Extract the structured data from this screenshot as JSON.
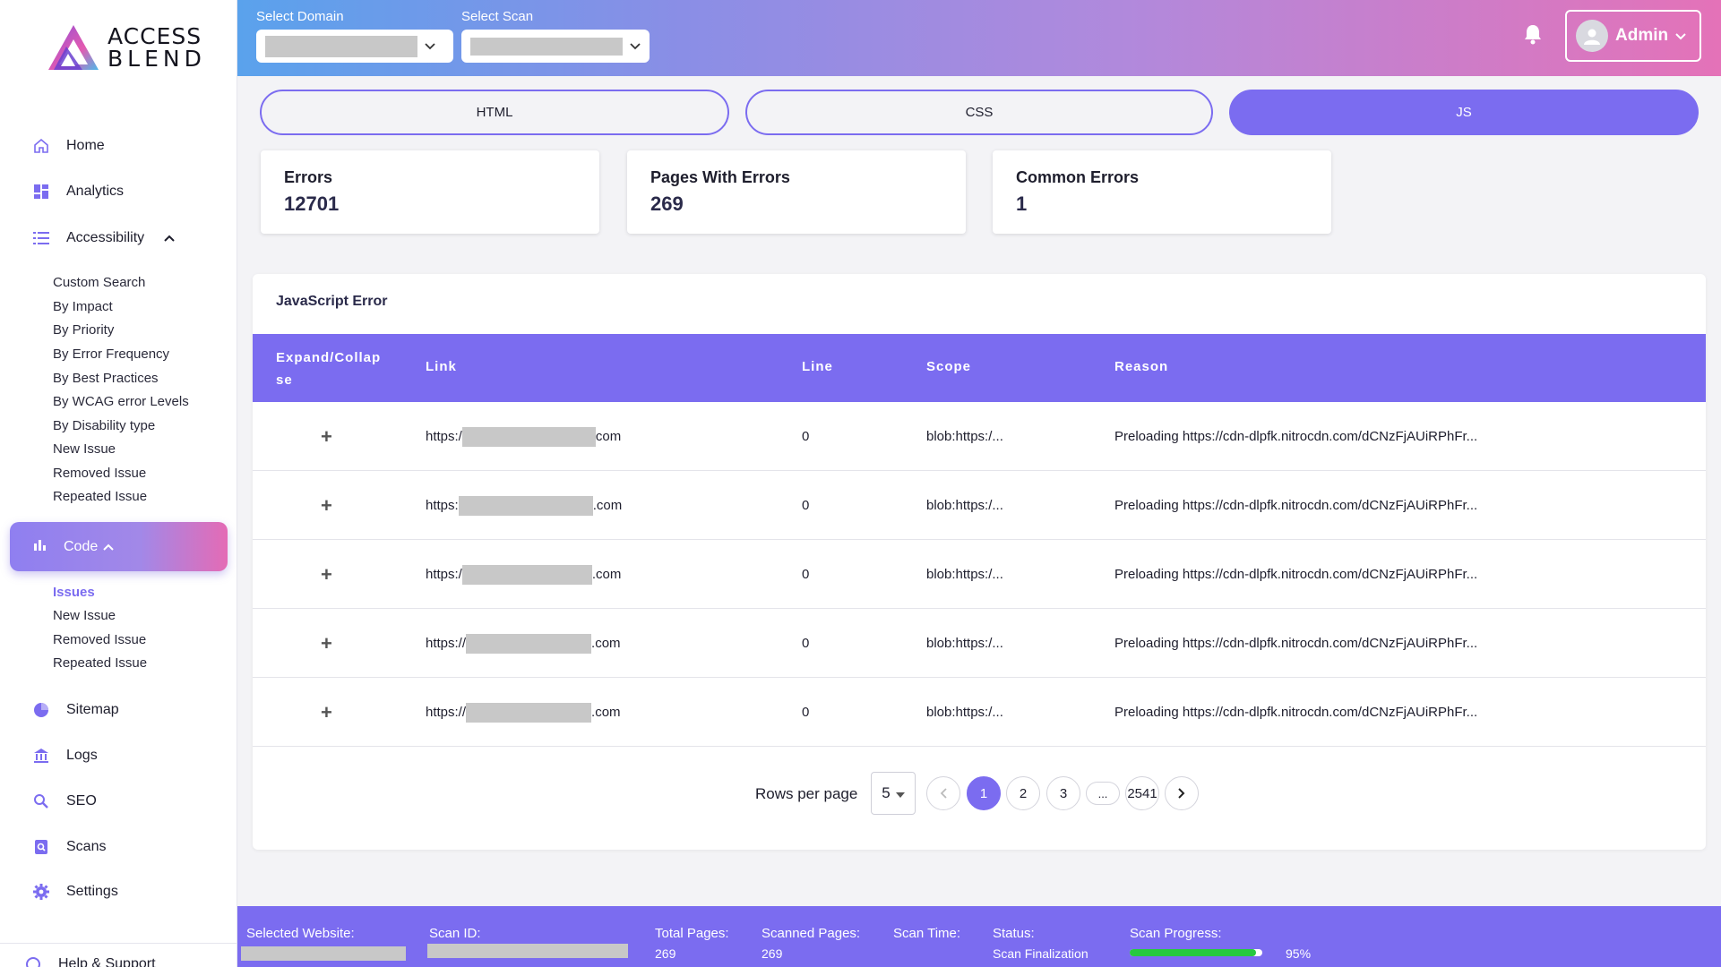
{
  "brand": {
    "line1": "ACCESS",
    "line2": "BLEND"
  },
  "colors": {
    "accent": "#7b6cf0",
    "header_start": "#5aa2ec",
    "header_end": "#e472b8",
    "progress": "#27c93f"
  },
  "header": {
    "domain_label": "Select Domain",
    "scan_label": "Select Scan",
    "admin_label": "Admin",
    "bell_icon": "bell-icon"
  },
  "sidebar": {
    "home": "Home",
    "analytics": "Analytics",
    "accessibility": "Accessibility",
    "accessibility_items": [
      "Custom Search",
      "By Impact",
      "By Priority",
      "By Error Frequency",
      "By Best Practices",
      "By WCAG error Levels",
      "By Disability type",
      "New Issue",
      "Removed Issue",
      "Repeated Issue"
    ],
    "code": "Code",
    "code_items": [
      "Issues",
      "New Issue",
      "Removed Issue",
      "Repeated Issue"
    ],
    "sitemap": "Sitemap",
    "logs": "Logs",
    "seo": "SEO",
    "scans": "Scans",
    "settings": "Settings",
    "help": "Help & Support"
  },
  "tabs": {
    "html": "HTML",
    "css": "CSS",
    "js": "JS",
    "active": "JS"
  },
  "stats": {
    "errors_label": "Errors",
    "errors_value": "12701",
    "pages_label": "Pages With Errors",
    "pages_value": "269",
    "common_label": "Common Errors",
    "common_value": "1"
  },
  "table": {
    "title": "JavaScript Error",
    "headers": {
      "expand": "Expand/Collap se",
      "link": "Link",
      "line": "Line",
      "scope": "Scope",
      "reason": "Reason"
    },
    "rows": [
      {
        "expand": "+",
        "link_prefix": "https:/",
        "link_suffix": "com",
        "line": "0",
        "scope": "blob:https:/...",
        "reason": "Preloading https://cdn-dlpfk.nitrocdn.com/dCNzFjAUiRPhFr..."
      },
      {
        "expand": "+",
        "link_prefix": "https:",
        "link_suffix": ".com",
        "line": "0",
        "scope": "blob:https:/...",
        "reason": "Preloading https://cdn-dlpfk.nitrocdn.com/dCNzFjAUiRPhFr..."
      },
      {
        "expand": "+",
        "link_prefix": "https:/",
        "link_suffix": ".com",
        "line": "0",
        "scope": "blob:https:/...",
        "reason": "Preloading https://cdn-dlpfk.nitrocdn.com/dCNzFjAUiRPhFr..."
      },
      {
        "expand": "+",
        "link_prefix": "https://",
        "link_suffix": ".com",
        "line": "0",
        "scope": "blob:https:/...",
        "reason": "Preloading https://cdn-dlpfk.nitrocdn.com/dCNzFjAUiRPhFr..."
      },
      {
        "expand": "+",
        "link_prefix": "https://",
        "link_suffix": ".com",
        "line": "0",
        "scope": "blob:https:/...",
        "reason": "Preloading https://cdn-dlpfk.nitrocdn.com/dCNzFjAUiRPhFr..."
      }
    ]
  },
  "pagination": {
    "rows_per_page_label": "Rows per page",
    "rows_per_page": "5",
    "pages": [
      "1",
      "2",
      "3",
      "...",
      "2541"
    ],
    "current": "1"
  },
  "footer": {
    "website_label": "Selected Website:",
    "scan_id_label": "Scan ID:",
    "total_pages_label": "Total Pages:",
    "total_pages_value": "269",
    "scanned_pages_label": "Scanned Pages:",
    "scanned_pages_value": "269",
    "scan_time_label": "Scan Time:",
    "status_label": "Status:",
    "status_value": "Scan Finalization",
    "progress_label": "Scan Progress:",
    "progress_value": "95%",
    "progress_fraction": 0.95
  }
}
